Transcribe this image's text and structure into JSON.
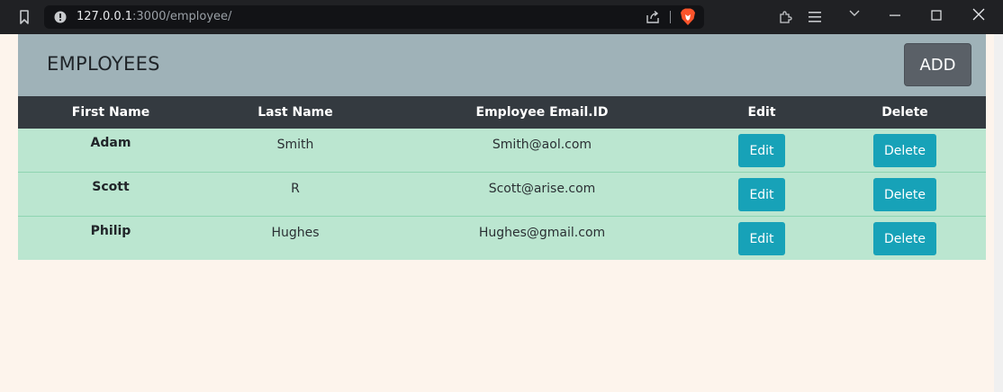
{
  "browser": {
    "url_host": "127.0.0.1",
    "url_path": ":3000/employee/"
  },
  "page": {
    "title": "EMPLOYEES",
    "add_label": "ADD"
  },
  "table": {
    "headers": [
      "First Name",
      "Last Name",
      "Employee Email.ID",
      "Edit",
      "Delete"
    ],
    "rows": [
      {
        "first": "Adam",
        "last": "Smith",
        "email": "Smith@aol.com",
        "edit": "Edit",
        "delete": "Delete"
      },
      {
        "first": "Scott",
        "last": "R",
        "email": "Scott@arise.com",
        "edit": "Edit",
        "delete": "Delete"
      },
      {
        "first": "Philip",
        "last": "Hughes",
        "email": "Hughes@gmail.com",
        "edit": "Edit",
        "delete": "Delete"
      }
    ]
  },
  "colors": {
    "header_bg": "#9fb2b8",
    "table_head_bg": "#343a40",
    "row_bg": "#bbe6d0",
    "action_button": "#17a2b8",
    "add_button": "#5a6067",
    "page_bg": "#fdf4ec"
  },
  "icons": [
    "bookmark-icon",
    "info-icon",
    "share-icon",
    "brave-lion-icon",
    "extensions-icon",
    "menu-icon",
    "tab-search-icon",
    "minimize-icon",
    "maximize-icon",
    "close-icon"
  ]
}
